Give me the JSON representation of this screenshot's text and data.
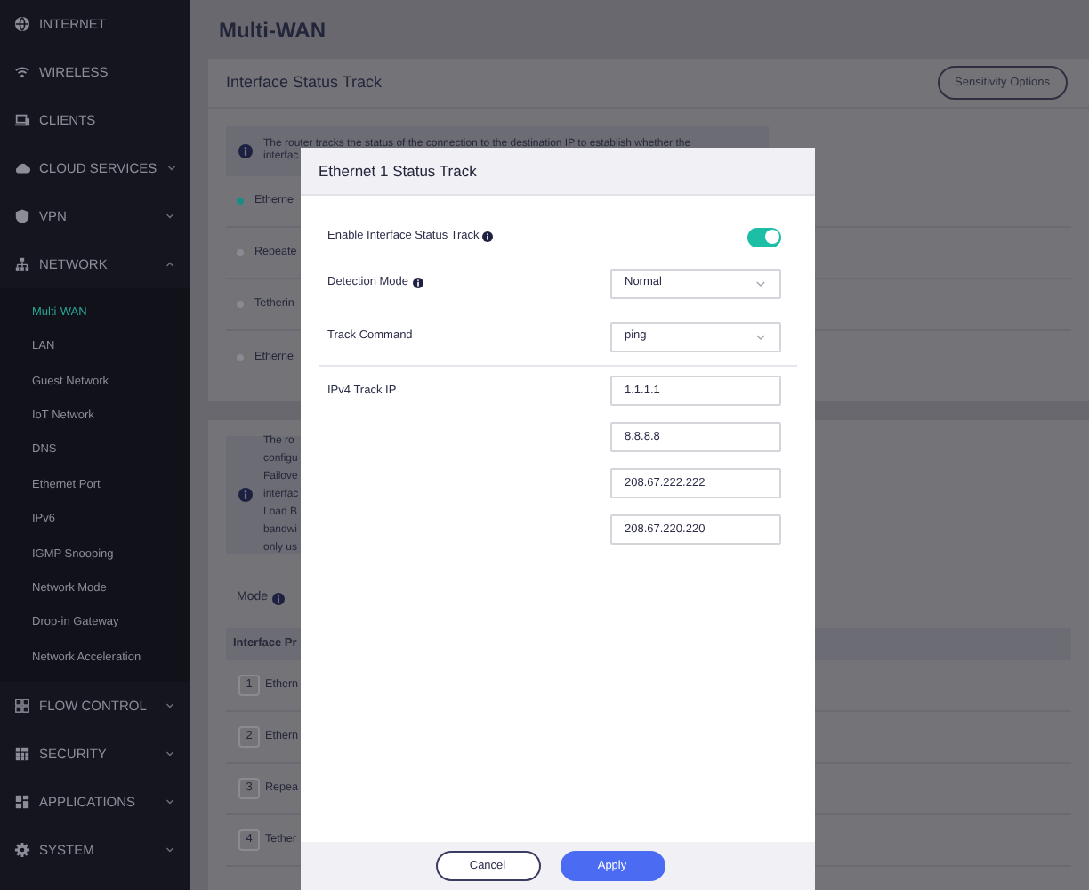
{
  "sidebar": {
    "items": [
      {
        "label": "INTERNET",
        "kind": "link"
      },
      {
        "label": "WIRELESS",
        "kind": "link"
      },
      {
        "label": "CLIENTS",
        "kind": "link"
      },
      {
        "label": "CLOUD SERVICES",
        "kind": "menu",
        "expanded": false
      },
      {
        "label": "VPN",
        "kind": "menu",
        "expanded": false
      },
      {
        "label": "NETWORK",
        "kind": "menu",
        "expanded": true,
        "children": [
          {
            "label": "Multi-WAN",
            "selected": true
          },
          {
            "label": "LAN",
            "selected": false
          },
          {
            "label": "Guest Network",
            "selected": false
          },
          {
            "label": "IoT Network",
            "selected": false
          },
          {
            "label": "DNS",
            "selected": false
          },
          {
            "label": "Ethernet Port",
            "selected": false
          },
          {
            "label": "IPv6",
            "selected": false
          },
          {
            "label": "IGMP Snooping",
            "selected": false
          },
          {
            "label": "Network Mode",
            "selected": false
          },
          {
            "label": "Drop-in Gateway",
            "selected": false
          },
          {
            "label": "Network Acceleration",
            "selected": false
          }
        ]
      },
      {
        "label": "FLOW CONTROL",
        "kind": "menu",
        "expanded": false
      },
      {
        "label": "SECURITY",
        "kind": "menu",
        "expanded": false
      },
      {
        "label": "APPLICATIONS",
        "kind": "menu",
        "expanded": false
      },
      {
        "label": "SYSTEM",
        "kind": "menu",
        "expanded": false
      }
    ]
  },
  "page": {
    "title": "Multi-WAN"
  },
  "status_card": {
    "title": "Interface Status Track",
    "button": "Sensitivity Options",
    "info_lines": [
      "The router tracks the status of the connection to the destination IP to establish whether the",
      "interfac"
    ],
    "interfaces": [
      {
        "label": "Etherne",
        "active": true
      },
      {
        "label": "Repeate",
        "active": false
      },
      {
        "label": "Tetherin",
        "active": false
      },
      {
        "label": "Etherne",
        "active": false
      }
    ]
  },
  "mode_card": {
    "info_lines": [
      "The ro",
      "configu",
      "Failove",
      "interfac",
      "Load B",
      "bandwi",
      "only us"
    ],
    "mode_label": "Mode",
    "table_header": "Interface Pr",
    "rows": [
      {
        "number": "1",
        "label": "Ethern"
      },
      {
        "number": "2",
        "label": "Ethern"
      },
      {
        "number": "3",
        "label": "Repea"
      },
      {
        "number": "4",
        "label": "Tether"
      }
    ]
  },
  "dialog": {
    "title": "Ethernet 1 Status Track",
    "rows": [
      {
        "kind": "toggle",
        "label": "Enable Interface Status Track",
        "info": true,
        "on": true
      },
      {
        "kind": "select",
        "label": "Detection Mode",
        "info": true,
        "value": "Normal"
      },
      {
        "kind": "select",
        "label": "Track Command",
        "info": false,
        "value": "ping"
      },
      {
        "kind": "ip_list",
        "label": "IPv4 Track IP",
        "info": false,
        "values": [
          "1.1.1.1",
          "8.8.8.8",
          "208.67.222.222",
          "208.67.220.220"
        ]
      }
    ],
    "buttons": [
      {
        "label": "Cancel",
        "kind": "secondary"
      },
      {
        "label": "Apply",
        "kind": "primary"
      }
    ]
  }
}
